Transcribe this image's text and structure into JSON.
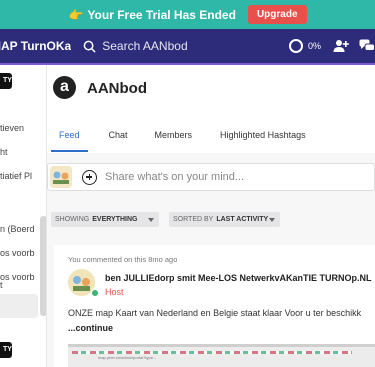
{
  "banner": {
    "text": "Your Free Trial Has Ended",
    "upgrade_label": "Upgrade",
    "color": "#2fb8a8",
    "upgrade_color": "#e8504b"
  },
  "topbar": {
    "brand": "MAP TurnOKay",
    "search_placeholder": "Search AANbod",
    "progress_text": "0%",
    "background": "#2c2c7a"
  },
  "sidebar": {
    "badge_top": "TY",
    "items": [
      "tieven",
      "ht",
      "tiatief Pl",
      "n (Boerd",
      "os voorb",
      "os voorb",
      "t"
    ],
    "badge_bottom": "TY"
  },
  "group": {
    "logo_letter": "a",
    "title": "AANbod",
    "tabs": [
      "Feed",
      "Chat",
      "Members",
      "Highlighted Hashtags"
    ],
    "active_tab": "Feed"
  },
  "composer": {
    "placeholder": "Share what's on your mind..."
  },
  "filters": {
    "showing_label": "SHOWING",
    "showing_value": "EVERYTHING",
    "sort_label": "SORTED BY",
    "sort_value": "LAST ACTIVITY"
  },
  "post": {
    "meta": "You commented on this 8mo ago",
    "title": "ben JULLIEdorp smit Mee-LOS NetwerkvAKanTIE TURNOp.NL",
    "role": "Host",
    "body": "ONZE map Kaart van Nederland en Belgie staat klaar Voor u ter beschikk",
    "continue_label": "...continue",
    "image_url_text": "map.prier.co/admin/portal?type..."
  }
}
